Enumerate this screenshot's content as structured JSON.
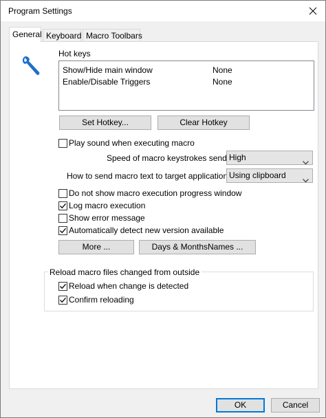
{
  "window": {
    "title": "Program Settings"
  },
  "tabs": [
    {
      "label": "General",
      "active": true
    },
    {
      "label": "Keyboard",
      "active": false
    },
    {
      "label": "Macro Toolbars",
      "active": false
    }
  ],
  "hotkeys": {
    "group_label": "Hot keys",
    "rows": [
      {
        "name": "Show/Hide main window",
        "value": "None"
      },
      {
        "name": "Enable/Disable Triggers",
        "value": "None"
      }
    ],
    "set_label": "Set Hotkey...",
    "clear_label": "Clear Hotkey"
  },
  "options": {
    "play_sound": {
      "label": "Play sound when executing macro",
      "checked": false
    },
    "speed": {
      "label": "Speed of macro keystrokes sending:",
      "value": "High"
    },
    "send_method": {
      "label": "How to send macro text to target application on",
      "value": "Using clipboard"
    },
    "no_progress": {
      "label": "Do not show macro execution progress window",
      "checked": false
    },
    "log": {
      "label": "Log macro execution",
      "checked": true
    },
    "show_error": {
      "label": "Show error message",
      "checked": false
    },
    "auto_detect": {
      "label": "Automatically detect new version available",
      "checked": true
    },
    "more_label": "More ...",
    "days_label": "Days & MonthsNames ..."
  },
  "reload": {
    "title": "Reload macro files changed from outside",
    "on_change": {
      "label": "Reload when change is detected",
      "checked": true
    },
    "confirm": {
      "label": "Confirm reloading",
      "checked": true
    }
  },
  "footer": {
    "ok_label": "OK",
    "cancel_label": "Cancel"
  },
  "colors": {
    "accent": "#0078d7",
    "wrench": "#1e6fc8"
  }
}
